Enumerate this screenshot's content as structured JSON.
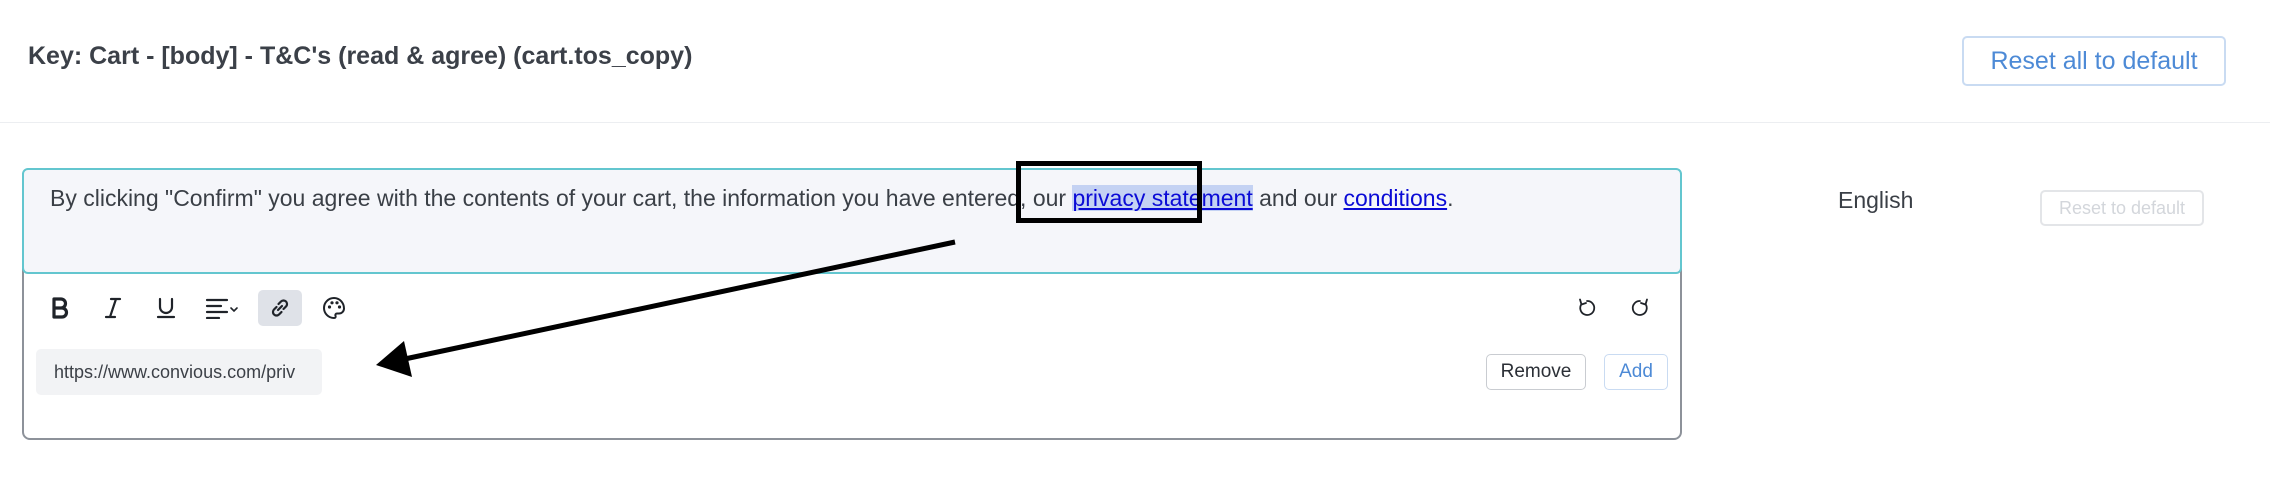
{
  "header": {
    "title": "Key: Cart - [body] - T&C's (read & agree) (cart.tos_copy)",
    "reset_all_label": "Reset all to default"
  },
  "editor": {
    "text_before": "By clicking \"Confirm\" you agree with the contents of your cart, the information you have entered, our ",
    "link_privacy": "privacy statement",
    "text_middle": " and our ",
    "link_conditions": "conditions",
    "text_after": ".",
    "toolbar": {
      "bold_icon": "bold-icon",
      "italic_icon": "italic-icon",
      "underline_icon": "underline-icon",
      "align_icon": "align-left-icon",
      "link_icon": "link-icon",
      "color_icon": "palette-icon",
      "undo_icon": "undo-icon",
      "redo_icon": "redo-icon"
    },
    "link_url_value": "https://www.convious.com/priv",
    "remove_label": "Remove",
    "add_label": "Add"
  },
  "side": {
    "language": "English",
    "reset_default_label": "Reset to default"
  },
  "colors": {
    "accent": "#4d8ad6",
    "link": "#0b0bd6",
    "focus_border": "#63c6cf",
    "annotation": "#000000"
  }
}
